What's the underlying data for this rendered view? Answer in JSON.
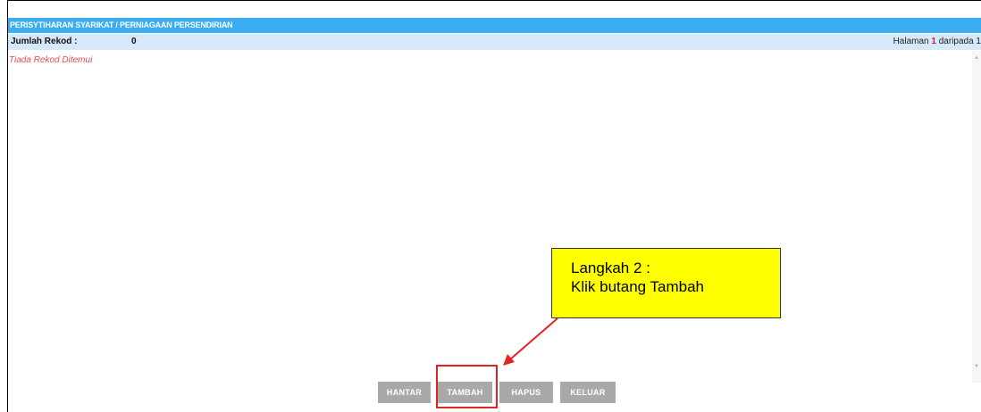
{
  "panel": {
    "title": "PERISYTIHARAN SYARIKAT / PERNIAGAAN PERSENDIRIAN",
    "record_label": "Jumlah Rekod :",
    "record_count": "0",
    "page_prefix": "Halaman",
    "page_current": "1",
    "page_suffix": "daripada 1",
    "empty_message": "Tiada Rekod Ditemui"
  },
  "buttons": {
    "hantar": "HANTAR",
    "tambah": "TAMBAH",
    "hapus": "HAPUS",
    "keluar": "KELUAR"
  },
  "callout": {
    "line1": "Langkah 2 :",
    "line2": "Klik butang Tambah"
  },
  "colors": {
    "title_bar": "#3aaef0",
    "info_bar": "#d5e9fb",
    "button": "#a9a9a9",
    "callout": "#ffff00",
    "highlight": "#e52222",
    "empty_text": "#e05050"
  },
  "icons": {
    "scroll_up": "scroll-up-arrow-icon",
    "scroll_down": "scroll-down-arrow-icon",
    "pointer": "red-arrow-icon"
  }
}
